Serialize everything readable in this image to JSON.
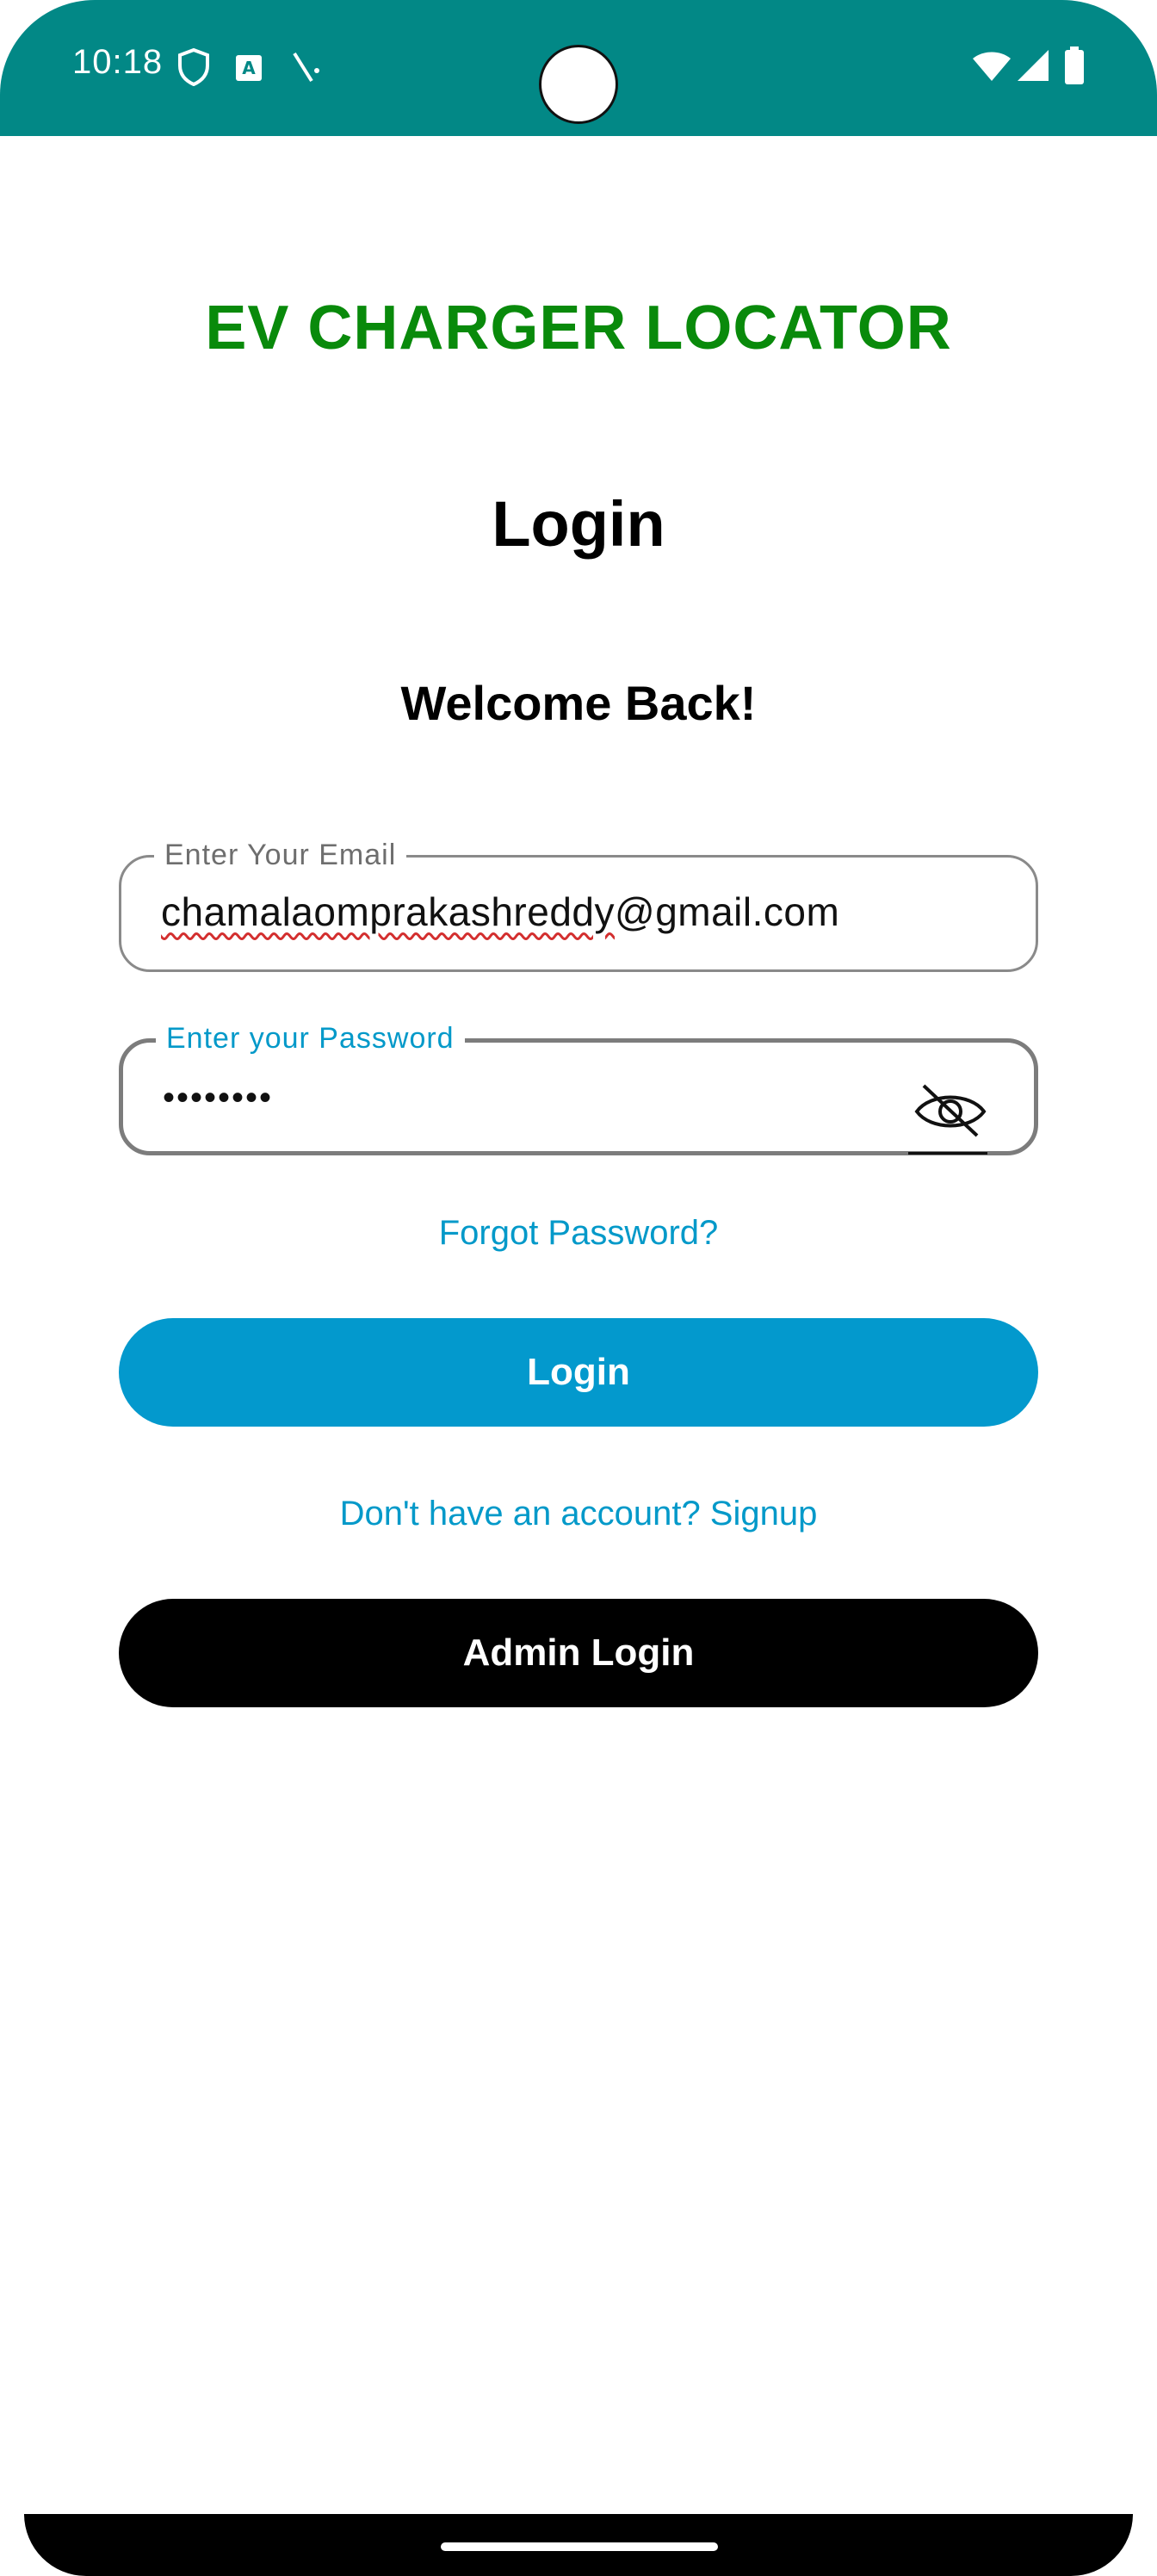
{
  "status_bar": {
    "time": "10:18",
    "left_icons": [
      "shield-icon",
      "keyboard-icon",
      "signal-slash-icon"
    ],
    "right_icons": [
      "wifi-icon",
      "cell-signal-icon",
      "battery-icon"
    ],
    "bg_color": "#028886"
  },
  "app": {
    "title": "EV CHARGER LOCATOR",
    "title_color": "#098a0b"
  },
  "page": {
    "title": "Login",
    "welcome": "Welcome Back!"
  },
  "form": {
    "email_label": "Enter Your Email",
    "email_value_underlined": "chamalaomprakashreddy",
    "email_value_rest": "@gmail.com",
    "password_label": "Enter your Password",
    "password_value": "••••••••"
  },
  "links": {
    "forgot": "Forgot Password?",
    "signup": "Don't have an account? Signup"
  },
  "buttons": {
    "login": "Login",
    "admin_login": "Admin Login",
    "login_color": "#0399cd",
    "admin_color": "#000000"
  }
}
